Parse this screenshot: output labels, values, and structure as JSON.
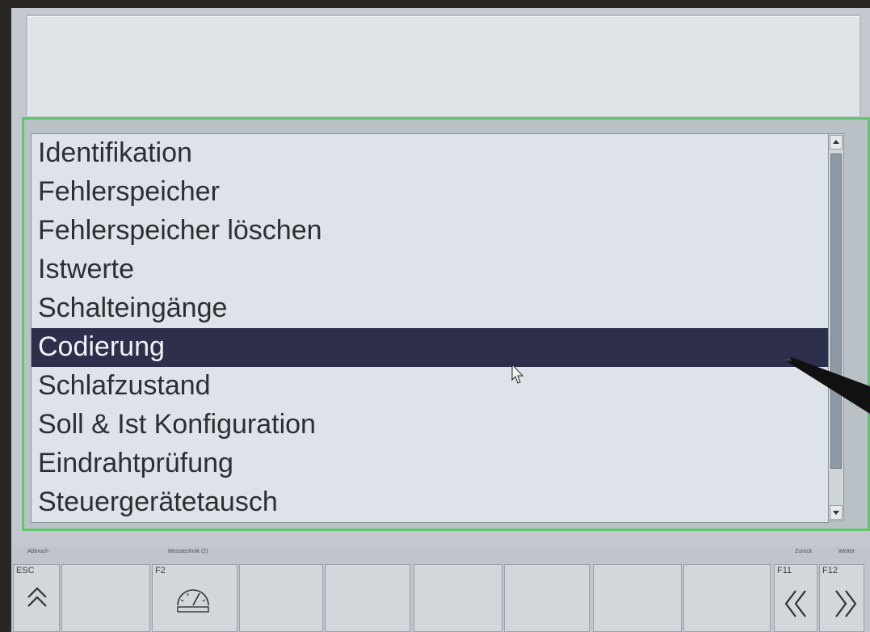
{
  "menu": {
    "items": [
      {
        "label": "Identifikation",
        "selected": false
      },
      {
        "label": "Fehlerspeicher",
        "selected": false
      },
      {
        "label": "Fehlerspeicher löschen",
        "selected": false
      },
      {
        "label": "Istwerte",
        "selected": false
      },
      {
        "label": "Schalteingänge",
        "selected": false
      },
      {
        "label": "Codierung",
        "selected": true
      },
      {
        "label": "Schlafzustand",
        "selected": false
      },
      {
        "label": "Soll & Ist Konfiguration",
        "selected": false
      },
      {
        "label": "Eindrahtprüfung",
        "selected": false
      },
      {
        "label": "Steuergerätetausch",
        "selected": false
      }
    ]
  },
  "fkeys": {
    "esc": {
      "code": "ESC",
      "caption": "Abbruch",
      "icon": "double-chevron-up-icon"
    },
    "f2": {
      "code": "F2",
      "caption": "Messtechnik (2)",
      "icon": "meter-gauge-icon"
    },
    "f11": {
      "code": "F11",
      "caption": "Zurück",
      "icon": "double-chevron-left-icon"
    },
    "f12": {
      "code": "F12",
      "caption": "Weiter",
      "icon": "double-chevron-right-icon"
    }
  },
  "colors": {
    "selection": "#2e2f4c",
    "frame_accent": "#5fc76a"
  }
}
